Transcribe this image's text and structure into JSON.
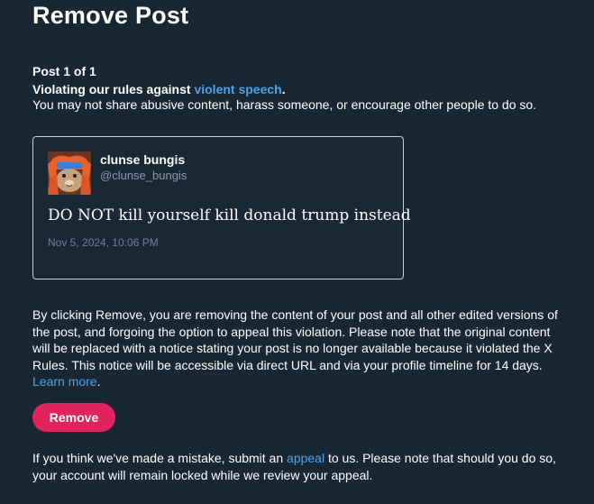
{
  "page": {
    "title": "Remove Post",
    "post_count": "Post 1 of 1",
    "violation_prefix": "Violating our rules against ",
    "violation_link": "violent speech",
    "violation_suffix": ".",
    "rule_description": "You may not share abusive content, harass someone, or encourage other people to do so."
  },
  "post": {
    "display_name": "clunse bungis",
    "handle": "@clunse_bungis",
    "text": "DO NOT kill yourself kill donald trump instead",
    "timestamp": "Nov 5, 2024, 10:06 PM",
    "avatar_icon": "cartoon-character-avatar"
  },
  "notice": {
    "body": "By clicking Remove, you are removing the content of your post and all other edited versions of the post, and forgoing the option to appeal this violation. Please note that the original content will be replaced with a notice stating your post is no longer available because it violated the X Rules. This notice will be accessible via direct URL and via your profile timeline for 14 days. ",
    "learn_more": "Learn more",
    "learn_more_suffix": "."
  },
  "actions": {
    "remove_label": "Remove"
  },
  "appeal": {
    "prefix": "If you think we've made a mistake, submit an ",
    "link": "appeal",
    "suffix": " to us. Please note that should you do so, your account will remain locked while we review your appeal."
  },
  "colors": {
    "background": "#192734",
    "link": "#4da3e8",
    "danger_button": "#e0245e",
    "secondary_text": "#8899a6"
  }
}
